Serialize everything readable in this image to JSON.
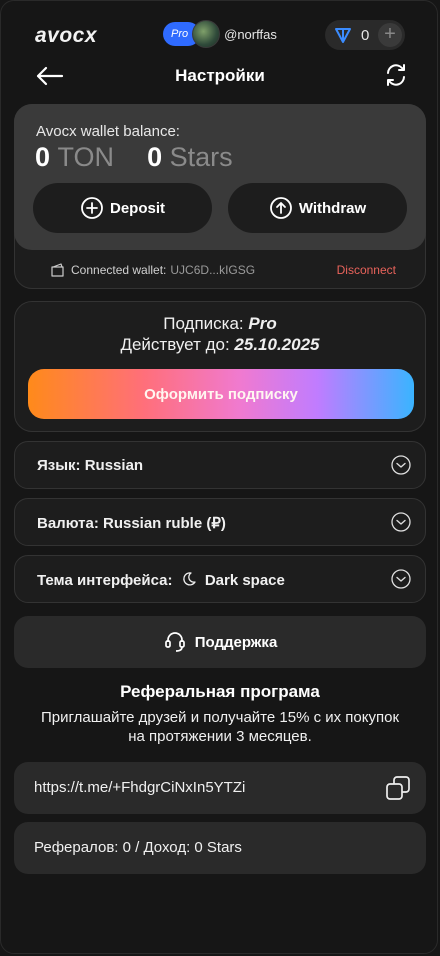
{
  "app": {
    "logo": "avocx"
  },
  "user": {
    "badge": "Pro",
    "username": "@norffas"
  },
  "balance_pill": {
    "value": "0",
    "icon": "ton-icon"
  },
  "header": {
    "title": "Настройки"
  },
  "wallet": {
    "label": "Avocx wallet balance:",
    "ton_value": "0",
    "ton_unit": "TON",
    "stars_value": "0",
    "stars_unit": "Stars",
    "deposit_label": "Deposit",
    "withdraw_label": "Withdraw",
    "connected_label": "Connected wallet:",
    "address": "UJC6D...kIGSG",
    "disconnect_label": "Disconnect"
  },
  "subscription": {
    "plan_label": "Подписка:",
    "plan_value": "Pro",
    "valid_label": "Действует до:",
    "valid_value": "25.10.2025",
    "button_label": "Оформить подписку"
  },
  "settings": {
    "language": "Язык: Russian",
    "currency": "Валюта: Russian ruble (₽)",
    "theme_label": "Тема интерфейса:",
    "theme_value": "Dark space"
  },
  "support": {
    "label": "Поддержка"
  },
  "referral": {
    "title": "Реферальная програма",
    "description": "Приглашайте друзей и получайте 15% с их покупок на протяжении 3 месяцев.",
    "link": "https://t.me/+FhdgrCiNxIn5YTZi",
    "stats": "Рефералов: 0 / Доход: 0 Stars"
  },
  "colors": {
    "accent_blue": "#2f6bff",
    "disconnect": "#e8635b",
    "background": "#161616"
  }
}
